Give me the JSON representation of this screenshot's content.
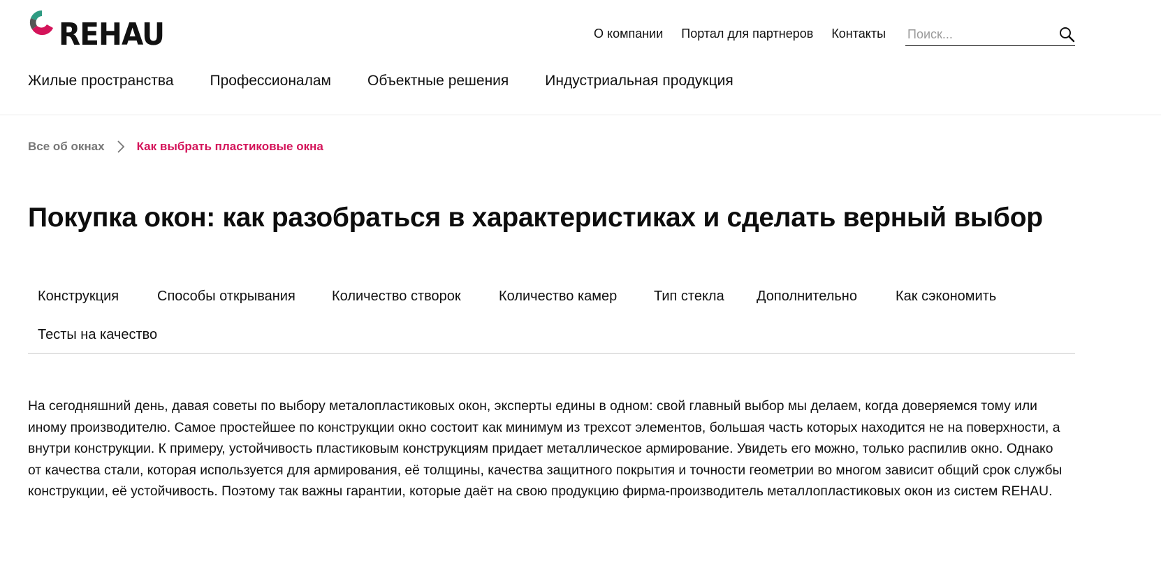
{
  "brand": {
    "logo_text": "REHAU",
    "colors": {
      "accent": "#d4145a",
      "logo_green": "#2e9b82",
      "logo_dark": "#333333",
      "breadcrumb_parent": "#777777"
    }
  },
  "header": {
    "top_links": [
      {
        "label": "О компании"
      },
      {
        "label": "Портал для партнеров"
      },
      {
        "label": "Контакты"
      }
    ],
    "search": {
      "placeholder": "Поиск...",
      "value": "",
      "icon": "search-icon"
    },
    "main_nav": [
      {
        "label": "Жилые пространства"
      },
      {
        "label": "Профессионалам"
      },
      {
        "label": "Объектные решения"
      },
      {
        "label": "Индустриальная продукция"
      }
    ]
  },
  "breadcrumb": {
    "parent": "Все об окнах",
    "separator_icon": "chevron-right-icon",
    "current": "Как выбрать пластиковые окна"
  },
  "page": {
    "title": "Покупка окон: как разобраться в характеристиках и сделать верный выбор"
  },
  "tabs": [
    {
      "label": "Конструкция"
    },
    {
      "label": "Способы открывания"
    },
    {
      "label": "Количество створок"
    },
    {
      "label": "Количество камер"
    },
    {
      "label": "Тип стекла"
    },
    {
      "label": "Дополнительно"
    },
    {
      "label": "Как сэкономить"
    },
    {
      "label": "Тесты на качество"
    }
  ],
  "content": {
    "intro": "На сегодняшний день, давая советы по выбору металопластиковых окон, эксперты едины в одном: свой главный выбор мы делаем, когда доверяемся тому или иному производителю. Самое простейшее по конструкции окно состоит как минимум из трехсот элементов, большая часть которых находится не на поверхности, а внутри конструкции. К примеру, устойчивость пластиковым конструкциям придает металлическое армирование. Увидеть его можно, только распилив окно. Однако от качества стали, которая используется для армирования, её толщины, качества защитного покрытия и точности геометрии во многом зависит общий срок службы конструкции, её устойчивость. Поэтому так важны гарантии, которые даёт на свою продукцию фирма-производитель металлопластиковых окон из систем REHAU."
  }
}
